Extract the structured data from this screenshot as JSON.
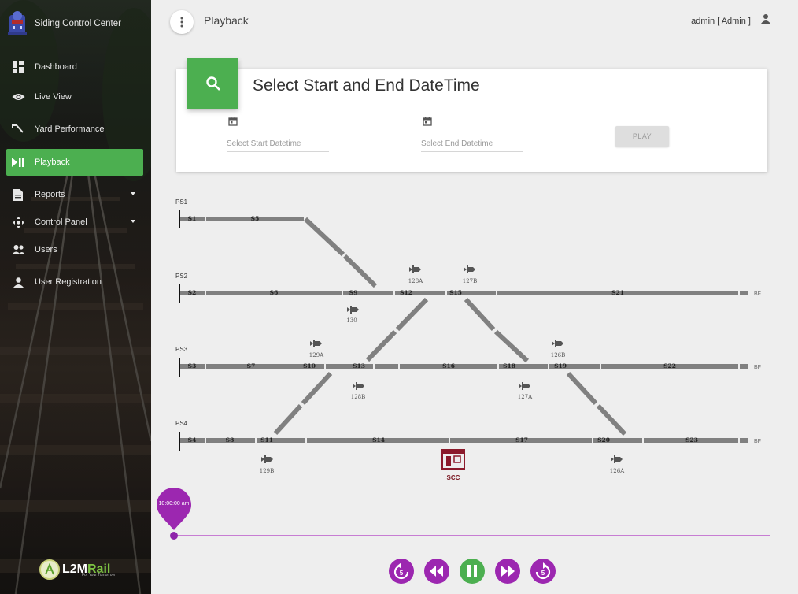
{
  "app": {
    "title": "Siding Control Center"
  },
  "sidebar": {
    "items": [
      {
        "label": "Dashboard",
        "icon": "dashboard-icon"
      },
      {
        "label": "Live View",
        "icon": "eye-icon"
      },
      {
        "label": "Yard Performance",
        "icon": "yard-icon"
      },
      {
        "label": "Playback",
        "icon": "play-pause-icon",
        "active": true
      },
      {
        "label": "Reports",
        "icon": "document-icon",
        "dropdown": true
      },
      {
        "label": "Control Panel",
        "icon": "move-icon",
        "dropdown": true
      },
      {
        "label": "Users",
        "icon": "users-icon"
      },
      {
        "label": "User Registration",
        "icon": "person-icon"
      }
    ],
    "footer_logo": {
      "brand_a": "L2M",
      "brand_b": "Rail",
      "tagline": "For Your Tomorrow"
    }
  },
  "header": {
    "title": "Playback",
    "user": "admin [ Admin ]"
  },
  "card": {
    "title": "Select Start and End DateTime",
    "start_placeholder": "Select Start Datetime",
    "end_placeholder": "Select End Datetime",
    "play_label": "PLAY"
  },
  "yard": {
    "platforms": [
      "PS1",
      "PS2",
      "PS3",
      "PS4"
    ],
    "end_label": "BF",
    "sections": {
      "ps1": [
        "S1",
        "S5"
      ],
      "ps2": [
        "S2",
        "S6",
        "S9",
        "S12",
        "S15",
        "S21"
      ],
      "ps3": [
        "S3",
        "S7",
        "S10",
        "S13",
        "S16",
        "S18",
        "S19",
        "S22"
      ],
      "ps4": [
        "S4",
        "S8",
        "S11",
        "S14",
        "S17",
        "S20",
        "S23"
      ]
    },
    "signals": [
      "128A",
      "127B",
      "130",
      "129A",
      "126B",
      "128B",
      "127A",
      "129B",
      "126A"
    ],
    "station": "SCC"
  },
  "timeline": {
    "current_time": "10:00:00 am",
    "progress": 0
  },
  "controls": [
    "replay-5-icon",
    "rewind-icon",
    "pause-icon",
    "fast-forward-icon",
    "forward-5-icon"
  ],
  "colors": {
    "accent_green": "#4caf50",
    "timeline_purple": "#9c27b0",
    "track_gray": "#808080",
    "station_red": "#8b1a2b"
  }
}
